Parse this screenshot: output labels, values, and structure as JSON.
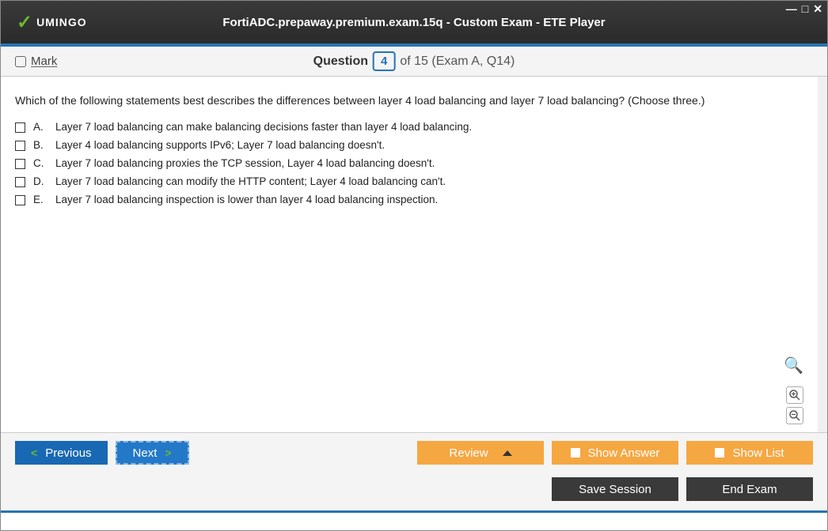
{
  "window": {
    "logo_text": "UMINGO",
    "title": "FortiADC.prepaway.premium.exam.15q - Custom Exam - ETE Player"
  },
  "header": {
    "mark_label": "Mark",
    "question_label": "Question",
    "question_number": "4",
    "of_text": "of 15 (Exam A, Q14)"
  },
  "question": {
    "text": "Which of the following statements best describes the differences between layer 4 load balancing and layer 7 load balancing? (Choose three.)",
    "options": [
      {
        "letter": "A.",
        "text": "Layer 7 load balancing can make balancing decisions faster than layer 4 load balancing."
      },
      {
        "letter": "B.",
        "text": "Layer 4 load balancing supports IPv6; Layer 7 load balancing doesn't."
      },
      {
        "letter": "C.",
        "text": "Layer 7 load balancing proxies the TCP session, Layer 4 load balancing doesn't."
      },
      {
        "letter": "D.",
        "text": "Layer 7 load balancing can modify the HTTP content; Layer 4 load balancing can't."
      },
      {
        "letter": "E.",
        "text": "Layer 7 load balancing inspection is lower than layer 4 load balancing inspection."
      }
    ]
  },
  "buttons": {
    "previous": "Previous",
    "next": "Next",
    "review": "Review",
    "show_answer": "Show Answer",
    "show_list": "Show List",
    "save_session": "Save Session",
    "end_exam": "End Exam"
  }
}
